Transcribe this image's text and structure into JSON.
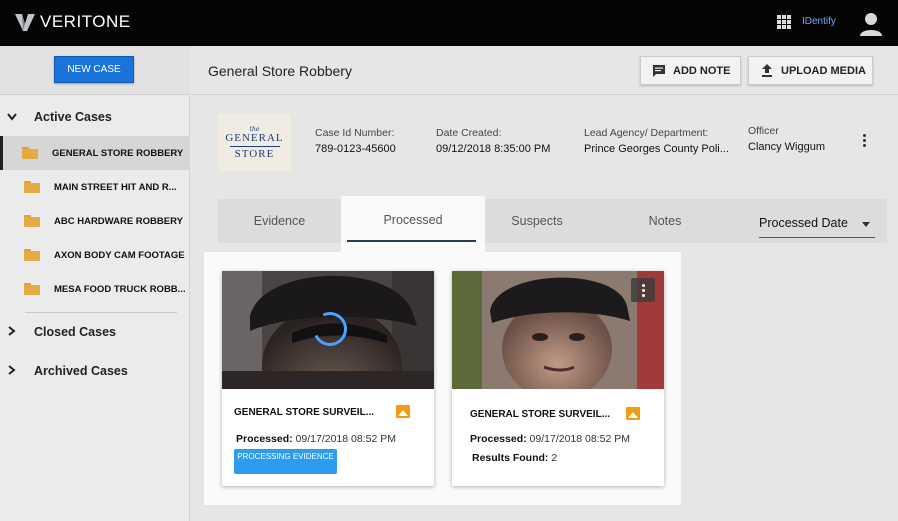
{
  "brand": {
    "name": "VERITONE"
  },
  "topbar": {
    "app_name": "IDentify"
  },
  "sidebar": {
    "new_case_label": "NEW CASE",
    "active_cases_label": "Active Cases",
    "cases": [
      "GENERAL STORE ROBBERY",
      "MAIN STREET HIT AND R...",
      "ABC HARDWARE ROBBERY",
      "AXON BODY CAM FOOTAGE",
      "MESA FOOD TRUCK ROBB..."
    ],
    "closed_cases_label": "Closed Cases",
    "archived_cases_label": "Archived Cases"
  },
  "header": {
    "title": "General Store Robbery",
    "add_note_label": "ADD NOTE",
    "upload_media_label": "UPLOAD MEDIA"
  },
  "case_info": {
    "logo": {
      "the": "the",
      "word1": "GENERAL",
      "word2": "STORE"
    },
    "case_id_label": "Case Id Number:",
    "case_id_value": "789-0123-45600",
    "date_label": "Date Created:",
    "date_value": "09/12/2018 8:35:00 PM",
    "agency_label": "Lead Agency/ Department:",
    "agency_value": "Prince Georges County Poli...",
    "officer_label": "Officer",
    "officer_value": "Clancy Wiggum"
  },
  "tabs": {
    "evidence": "Evidence",
    "processed": "Processed",
    "suspects": "Suspects",
    "notes": "Notes",
    "sort_selected": "Processed Date"
  },
  "cards": [
    {
      "title": "GENERAL STORE SURVEIL...",
      "processed_label": "Processed:",
      "processed_value": "09/17/2018 08:52 PM",
      "status": "PROCESSING EVIDENCE"
    },
    {
      "title": "GENERAL STORE SURVEIL...",
      "processed_label": "Processed:",
      "processed_value": "09/17/2018 08:52 PM",
      "results_label": "Results Found:",
      "results_value": "2"
    }
  ],
  "colors": {
    "primary": "#1a73d8",
    "badge": "#2d9cf0",
    "folder": "#e3ac42",
    "image_icon": "#f39c12"
  }
}
